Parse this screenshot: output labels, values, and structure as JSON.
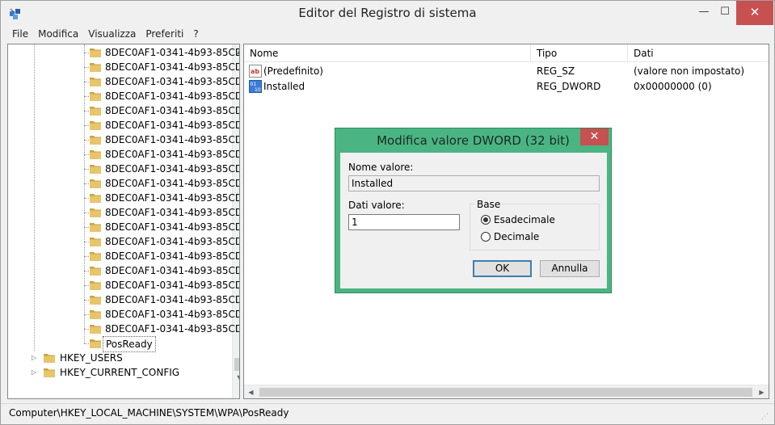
{
  "window": {
    "title": "Editor del Registro di sistema",
    "controls": {
      "minimize": "—",
      "maximize": "☐",
      "close": "✕"
    }
  },
  "menu": [
    "File",
    "Modifica",
    "Visualizza",
    "Preferiti",
    "?"
  ],
  "tree": {
    "guid_items": [
      "8DEC0AF1-0341-4b93-85CD-",
      "8DEC0AF1-0341-4b93-85CD-",
      "8DEC0AF1-0341-4b93-85CD-",
      "8DEC0AF1-0341-4b93-85CD-",
      "8DEC0AF1-0341-4b93-85CD-",
      "8DEC0AF1-0341-4b93-85CD-",
      "8DEC0AF1-0341-4b93-85CD-",
      "8DEC0AF1-0341-4b93-85CD-",
      "8DEC0AF1-0341-4b93-85CD-",
      "8DEC0AF1-0341-4b93-85CD-",
      "8DEC0AF1-0341-4b93-85CD-",
      "8DEC0AF1-0341-4b93-85CD-",
      "8DEC0AF1-0341-4b93-85CD-",
      "8DEC0AF1-0341-4b93-85CD-",
      "8DEC0AF1-0341-4b93-85CD-",
      "8DEC0AF1-0341-4b93-85CD-",
      "8DEC0AF1-0341-4b93-85CD-",
      "8DEC0AF1-0341-4b93-85CD-",
      "8DEC0AF1-0341-4b93-85CD-",
      "8DEC0AF1-0341-4b93-85CD-"
    ],
    "selected": "PosReady",
    "roots": [
      "HKEY_USERS",
      "HKEY_CURRENT_CONFIG"
    ],
    "colors": {
      "folder": "#e8c56a",
      "folder_dark": "#c9a441"
    }
  },
  "list": {
    "columns": [
      "Nome",
      "Tipo",
      "Dati"
    ],
    "rows": [
      {
        "icon": "string-value-icon",
        "name": "(Predefinito)",
        "type": "REG_SZ",
        "data": "(valore non impostato)"
      },
      {
        "icon": "binary-value-icon",
        "name": "Installed",
        "type": "REG_DWORD",
        "data": "0x00000000 (0)"
      }
    ]
  },
  "status": {
    "path": "Computer\\HKEY_LOCAL_MACHINE\\SYSTEM\\WPA\\PosReady"
  },
  "dialog": {
    "title": "Modifica valore DWORD (32 bit)",
    "close": "✕",
    "name_label": "Nome valore:",
    "name_value": "Installed",
    "data_label": "Dati valore:",
    "data_value": "1",
    "base_label": "Base",
    "radio_hex": "Esadecimale",
    "radio_dec": "Decimale",
    "selected_base": "hex",
    "ok": "OK",
    "cancel": "Annulla",
    "colors": {
      "frame": "#4ab583",
      "close": "#c75050"
    }
  }
}
